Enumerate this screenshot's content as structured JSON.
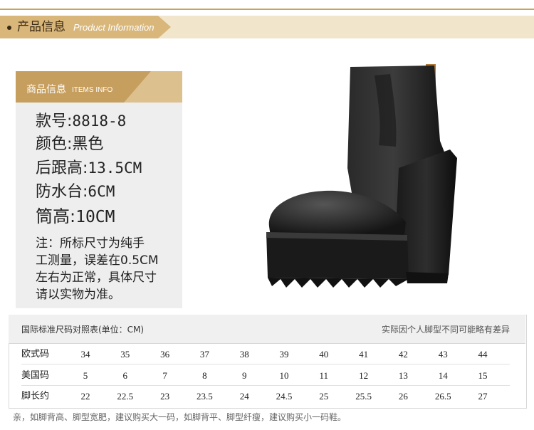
{
  "header": {
    "title_cn": "产品信息",
    "title_en": "Product Information"
  },
  "info": {
    "head_cn": "商品信息",
    "head_en": "ITEMS INFO",
    "specs": [
      {
        "label": "款号:",
        "value": "8818-8"
      },
      {
        "label": "颜色:",
        "value": "黑色"
      },
      {
        "label": "后跟高:",
        "value": "13.5CM"
      },
      {
        "label": "防水台:",
        "value": "6CM"
      },
      {
        "label": "筒高:",
        "value": "10CM"
      }
    ],
    "note_lines": [
      "注：所标尺寸为纯手",
      "工测量，误差在0.5CM",
      "左右为正常，具体尺寸",
      "请以实物为准。"
    ]
  },
  "size_table": {
    "title": "国际标准尺码对照表(单位：CM)",
    "note": "实际因个人脚型不同可能略有差异",
    "rows": [
      {
        "label": "欧式码",
        "values": [
          "34",
          "35",
          "36",
          "37",
          "38",
          "39",
          "40",
          "41",
          "42",
          "43",
          "44"
        ]
      },
      {
        "label": "美国码",
        "values": [
          "5",
          "6",
          "7",
          "8",
          "9",
          "10",
          "11",
          "12",
          "13",
          "14",
          "15"
        ]
      },
      {
        "label": "脚长约",
        "values": [
          "22",
          "22.5",
          "23",
          "23.5",
          "24",
          "24.5",
          "25",
          "25.5",
          "26",
          "26.5",
          "27"
        ]
      }
    ]
  },
  "footer": "亲，如脚背高、脚型宽肥，建议购买大一码，如脚背平、脚型纤瘦，建议购买小一码鞋。",
  "colors": {
    "accent_gold": "#c69e5e",
    "band": "#f1e6cc",
    "panel": "#eeeeee"
  }
}
